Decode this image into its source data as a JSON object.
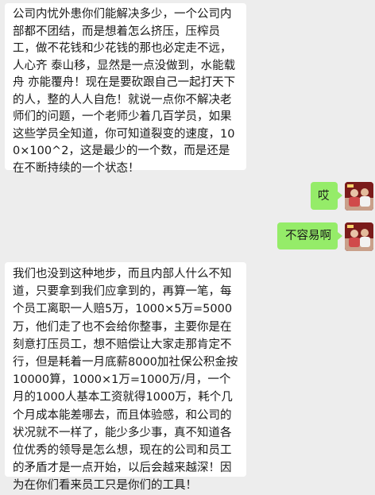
{
  "messages": [
    {
      "side": "left",
      "text": "公司内忧外患你们能解决多少，一个公司内部都不团结，而是想着怎么挤压，压榨员工，做不花钱和少花钱的那也必定走不远，人心齐 泰山移，显然是一点没做到，水能载舟 亦能覆舟！现在是要砍跟自己一起打天下的人，整的人人自危！就说一点你不解决老师们的问题，一个老师少着几百学员，如果这些学员全知道，你可知道裂变的速度，100×100^2，这是最少的一个数，而是还是在不断持续的一个状态！"
    },
    {
      "side": "right",
      "text": "哎"
    },
    {
      "side": "right",
      "text": "不容易啊"
    },
    {
      "side": "left",
      "text": "我们也没到这种地步，而且内部人什么不知道，只要拿到我们应拿到的，再算一笔，每个员工离职一人赔5万，1000×5万=5000万，他们走了也不会给你整事，主要你是在刻意打压员工，想不赔偿让大家走那肯定不行，但是耗着一月底薪8000加社保公积金按10000算，1000×1万=1000万/月，一个月的1000人基本工资就得1000万，耗个几个月成本能差哪去，而且体验感，和公司的状况就不一样了，能少多少事，真不知道各位优秀的领导是怎么想，现在的公司和员工的矛盾才是一点开始，以后会越来越深！因为在你们看来员工只是你们的工具！"
    }
  ],
  "colors": {
    "background": "#ededed",
    "received_bubble": "#ffffff",
    "sent_bubble": "#95ec69"
  },
  "avatar_icon": "user-avatar-icon"
}
